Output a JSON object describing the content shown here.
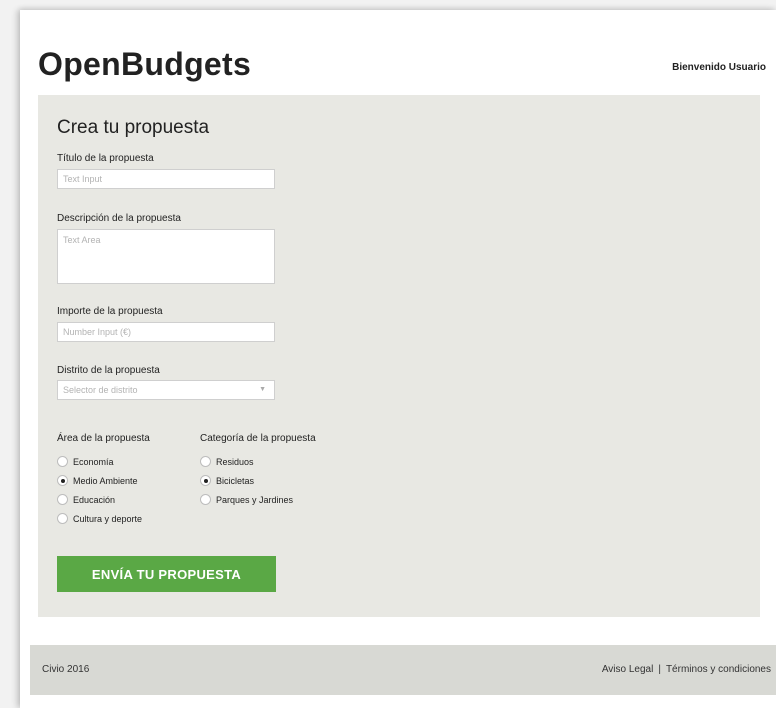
{
  "header": {
    "logo": "OpenBudgets",
    "welcome": "Bienvenido Usuario"
  },
  "form": {
    "title": "Crea tu propuesta",
    "title_field": {
      "label": "Título de la propuesta",
      "placeholder": "Text Input"
    },
    "description_field": {
      "label": "Descripción de la propuesta",
      "placeholder": "Text Area"
    },
    "amount_field": {
      "label": "Importe de la propuesta",
      "placeholder": "Number Input (€)"
    },
    "district_field": {
      "label": "Distrito de la propuesta",
      "placeholder": "Selector de distrito"
    },
    "area_group": {
      "label": "Área de la propuesta",
      "options": [
        {
          "label": "Economía",
          "checked": false
        },
        {
          "label": "Medio Ambiente",
          "checked": true
        },
        {
          "label": "Educación",
          "checked": false
        },
        {
          "label": "Cultura y deporte",
          "checked": false
        }
      ]
    },
    "category_group": {
      "label": "Categoría de la propuesta",
      "options": [
        {
          "label": "Residuos",
          "checked": false
        },
        {
          "label": "Bicicletas",
          "checked": true
        },
        {
          "label": "Parques y Jardines",
          "checked": false
        }
      ]
    },
    "submit_label": "ENVÍA TU PROPUESTA",
    "accent_color": "#5aa845"
  },
  "footer": {
    "copyright": "Civio 2016",
    "separator": "|",
    "links": [
      "Aviso Legal",
      "Términos y condiciones"
    ]
  }
}
